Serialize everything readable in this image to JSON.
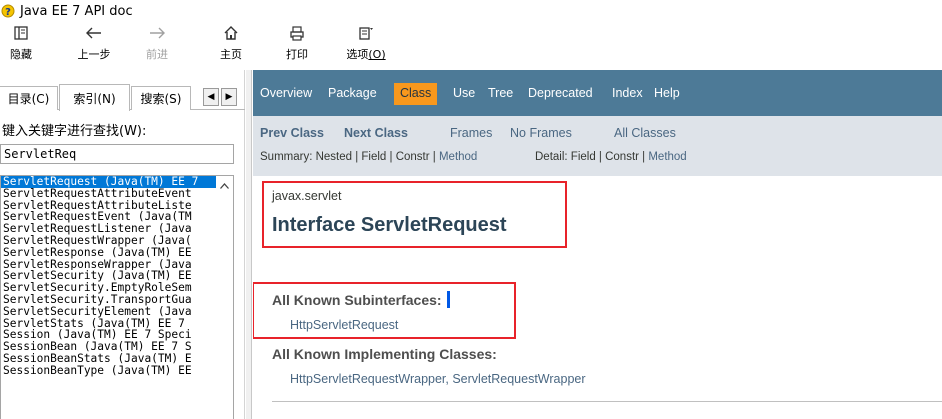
{
  "window": {
    "title": "Java EE 7 API doc"
  },
  "toolbar": {
    "hide_label": "隐藏",
    "back_label": "上一步",
    "forward_label": "前进",
    "home_label": "主页",
    "print_label": "打印",
    "options_label": "选项",
    "options_key": "(O)"
  },
  "left_pane": {
    "tabs": {
      "contents": "目录(C)",
      "index": "索引(N)",
      "search": "搜索(S)"
    },
    "keyword_label": "键入关键字进行查找(W):",
    "keyword_value": "ServletReq",
    "items": [
      "ServletRequest (Java(TM) EE 7",
      "ServletRequestAttributeEvent",
      "ServletRequestAttributeListe",
      "ServletRequestEvent (Java(TM",
      "ServletRequestListener (Java",
      "ServletRequestWrapper (Java(",
      "ServletResponse (Java(TM) EE",
      "ServletResponseWrapper (Java",
      "ServletSecurity (Java(TM) EE",
      "ServletSecurity.EmptyRoleSem",
      "ServletSecurity.TransportGua",
      "ServletSecurityElement (Java",
      "ServletStats (Java(TM) EE 7",
      "Session (Java(TM) EE 7 Speci",
      "SessionBean (Java(TM) EE 7 S",
      "SessionBeanStats (Java(TM) E",
      "SessionBeanType (Java(TM) EE"
    ]
  },
  "doc": {
    "nav": {
      "overview": "Overview",
      "package": "Package",
      "class": "Class",
      "use": "Use",
      "tree": "Tree",
      "deprecated": "Deprecated",
      "index": "Index",
      "help": "Help"
    },
    "subnav": {
      "prev_class": "Prev Class",
      "next_class": "Next Class",
      "frames": "Frames",
      "no_frames": "No Frames",
      "all_classes": "All Classes",
      "summary_prefix": "Summary: Nested | Field | Constr | ",
      "summary_method": "Method",
      "detail_prefix": "Detail: Field | Constr | ",
      "detail_method": "Method"
    },
    "package_name": "javax.servlet",
    "interface_title": "Interface ServletRequest",
    "subinterfaces_label": "All Known Subinterfaces:",
    "subinterfaces_value": "HttpServletRequest",
    "implementing_label": "All Known Implementing Classes:",
    "implementing_value": "HttpServletRequestWrapper, ServletRequestWrapper"
  },
  "colors": {
    "nav_bg": "#4d7a97",
    "nav_active_bg": "#f8981d",
    "subnav_bg": "#dee3e9",
    "link": "#4a6782",
    "highlight_box": "#e8232a",
    "selection": "#0078d7"
  }
}
